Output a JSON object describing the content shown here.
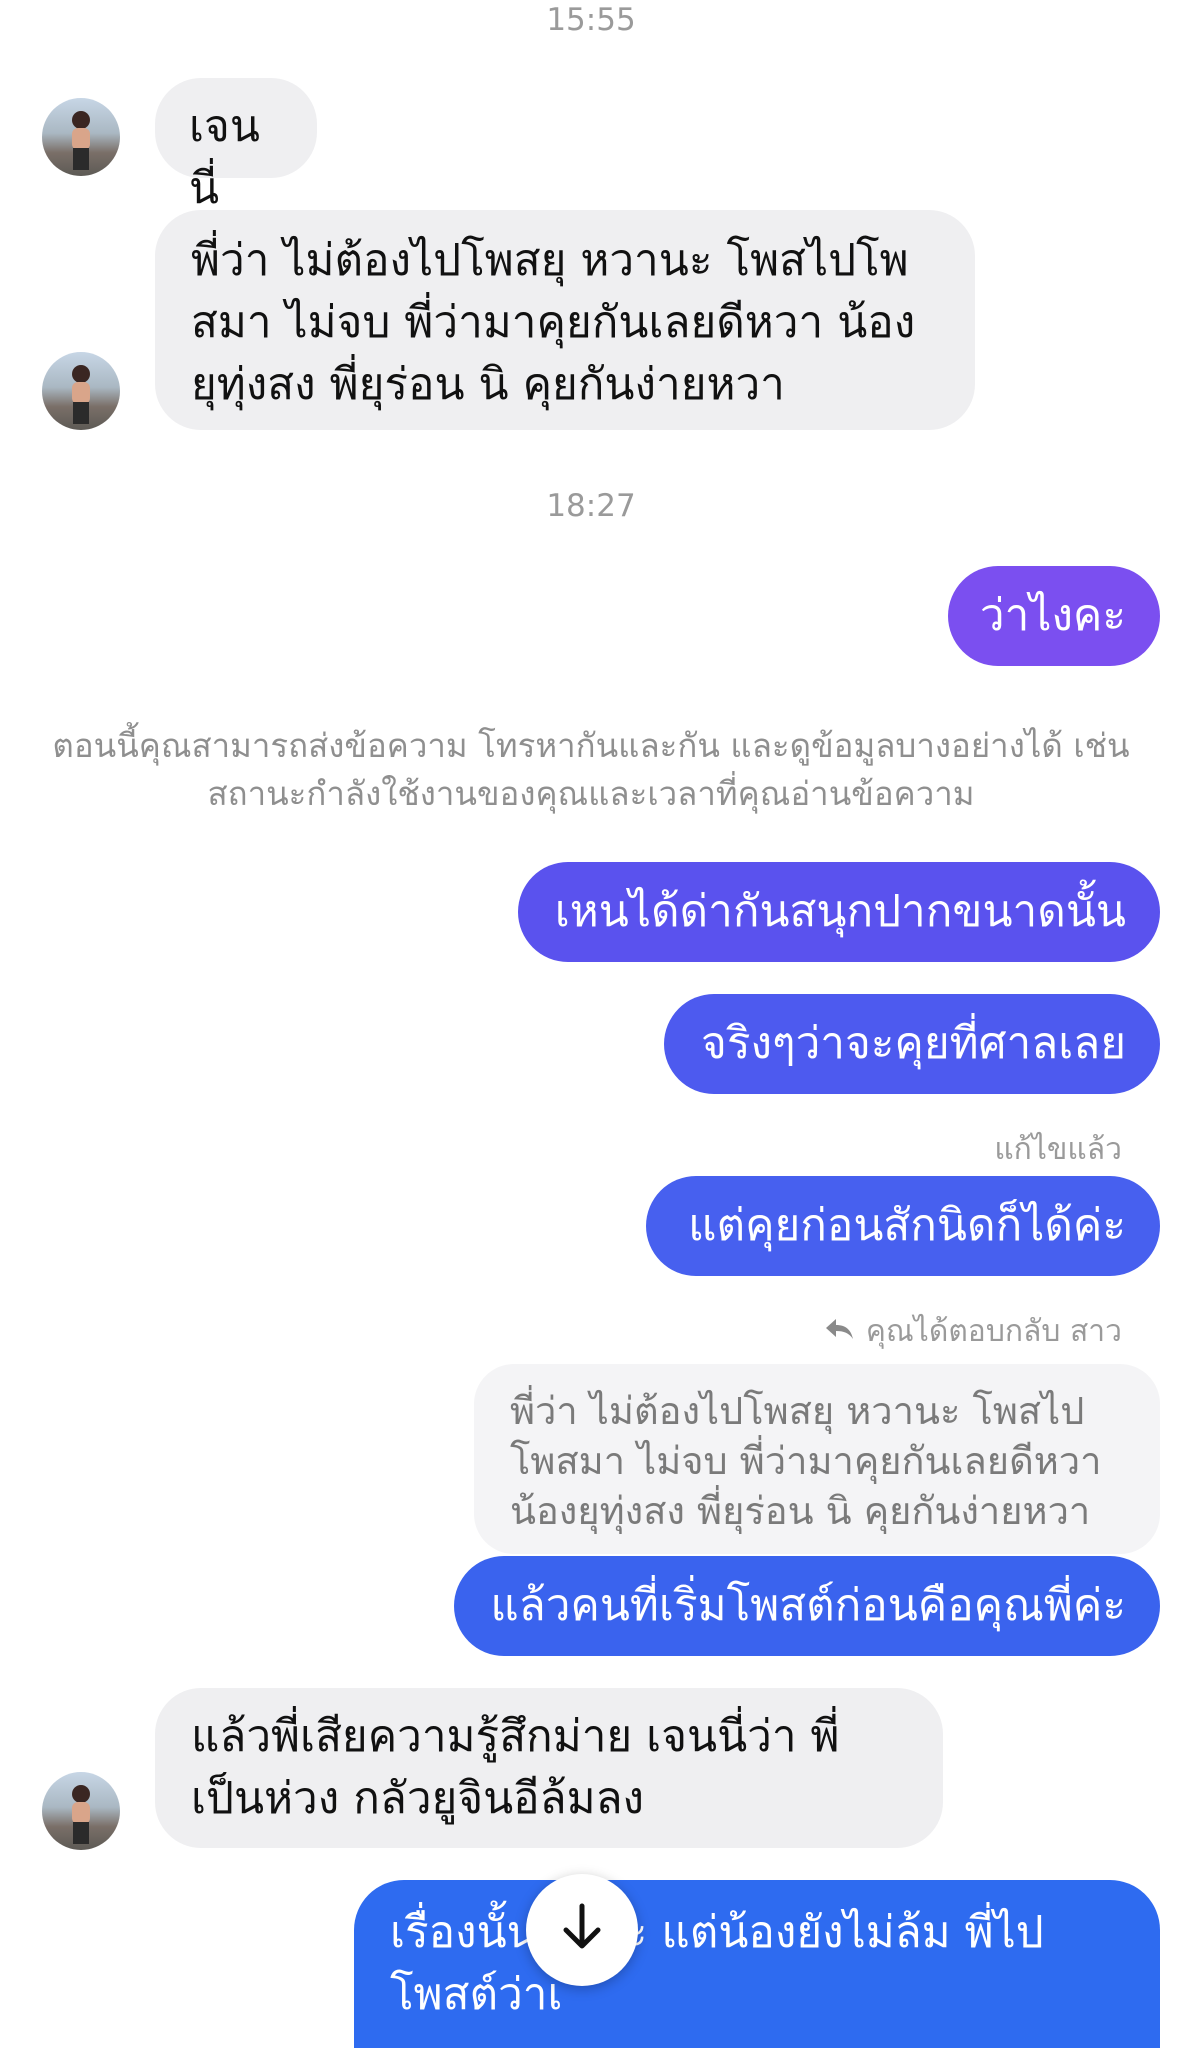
{
  "timestamps": [
    "15:55",
    "18:27"
  ],
  "messages": {
    "m1": "เจนนี่",
    "m2": "พี่ว่า ไม่ต้องไปโพสยุ หวานะ โพสไปโพสมา ไม่จบ พี่ว่ามาคุยกันเลยดีหวา น้องยุทุ่งสง พี่ยุร่อน นิ คุยกันง่ายหวา",
    "m3": "ว่าไงคะ",
    "m4": "เหนได้ด่ากันสนุกปากขนาดนั้น",
    "m5": "จริงๆว่าจะคุยที่ศาลเลย",
    "m6": "แต่คุยก่อนสักนิดก็ได้ค่ะ",
    "m7": "แล้วคนที่เริ่มโพสต์ก่อนคือคุณพี่ค่ะ",
    "m8": "แล้วพี่เสียความรู้สึกม่าย เจนนี่ว่า พี่เป็นห่วง กลัวยูจินอีล้มลง",
    "m9": "เรื่องนั้นเ  ดีค่ะ แต่น้องยังไม่ล้ม พี่ไปโพสต์ว่าเ"
  },
  "system_notice": "ตอนนี้คุณสามารถส่งข้อความ โทรหากันและกัน และดูข้อมูลบางอย่างได้ เช่น สถานะกำลังใช้งานของคุณและเวลาที่คุณอ่านข้อความ",
  "edited_label": "แก้ไขแล้ว",
  "reply_label": "คุณได้ตอบกลับ สาว",
  "quoted_text": "พี่ว่า ไม่ต้องไปโพสยุ หวานะ โพสไปโพสมา ไม่จบ พี่ว่ามาคุยกันเลยดีหวา น้องยุทุ่งสง พี่ยุร่อน นิ คุยกันง่ายหวา",
  "colors": {
    "incoming_bubble": "#efeff1",
    "outgoing_purple": "#7b4ff0",
    "outgoing_indigo": "#5a52ee",
    "outgoing_blue": "#3a63ee",
    "outgoing_blue_dark": "#2e6bf0"
  },
  "icons": [
    "reply-arrow-icon",
    "arrow-down-icon"
  ]
}
